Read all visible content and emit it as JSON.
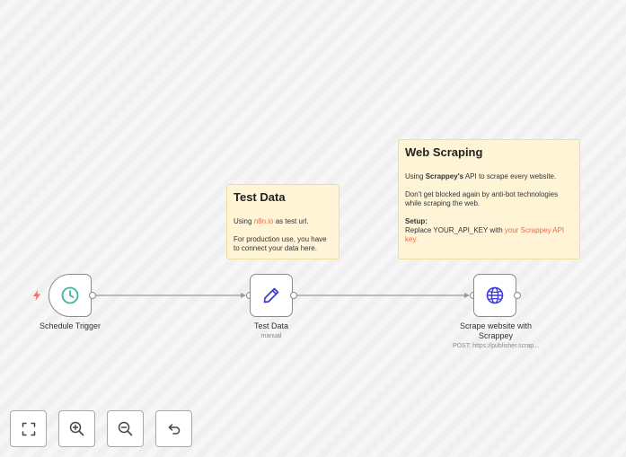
{
  "canvas": {
    "sticky_notes": [
      {
        "title": "Test Data",
        "line1_prefix": "Using ",
        "line1_link": "n8n.io",
        "line1_suffix": " as test url.",
        "line2": "For production use, you have to connect your data here."
      },
      {
        "title": "Web Scraping",
        "line1_prefix": "Using ",
        "line1_bold": "Scrappey's",
        "line1_suffix": " API to scrape every website.",
        "line2": "Don't get blocked again by anti-bot technologies while scraping the web.",
        "setup_label": "Setup:",
        "setup_prefix": "Replace YOUR_API_KEY with ",
        "setup_link": "your Scrappey API key."
      }
    ],
    "nodes": [
      {
        "label": "Schedule Trigger",
        "icon": "clock-icon",
        "icon_color": "#3bb69e"
      },
      {
        "label": "Test Data",
        "subtitle": "manual",
        "icon": "pencil-icon",
        "icon_color": "#3b3bdb"
      },
      {
        "label": "Scrape website with Scrappey",
        "subtitle": "POST: https://publisher.scrap...",
        "icon": "globe-icon",
        "icon_color": "#3b3bdb"
      }
    ],
    "trigger_marker_color": "#ff6d5a",
    "link_color": "#e96a4d",
    "sticky_color": "#fff5d6"
  },
  "controls": [
    {
      "icon": "fit-view-icon"
    },
    {
      "icon": "zoom-in-icon"
    },
    {
      "icon": "zoom-out-icon"
    },
    {
      "icon": "undo-icon"
    }
  ]
}
